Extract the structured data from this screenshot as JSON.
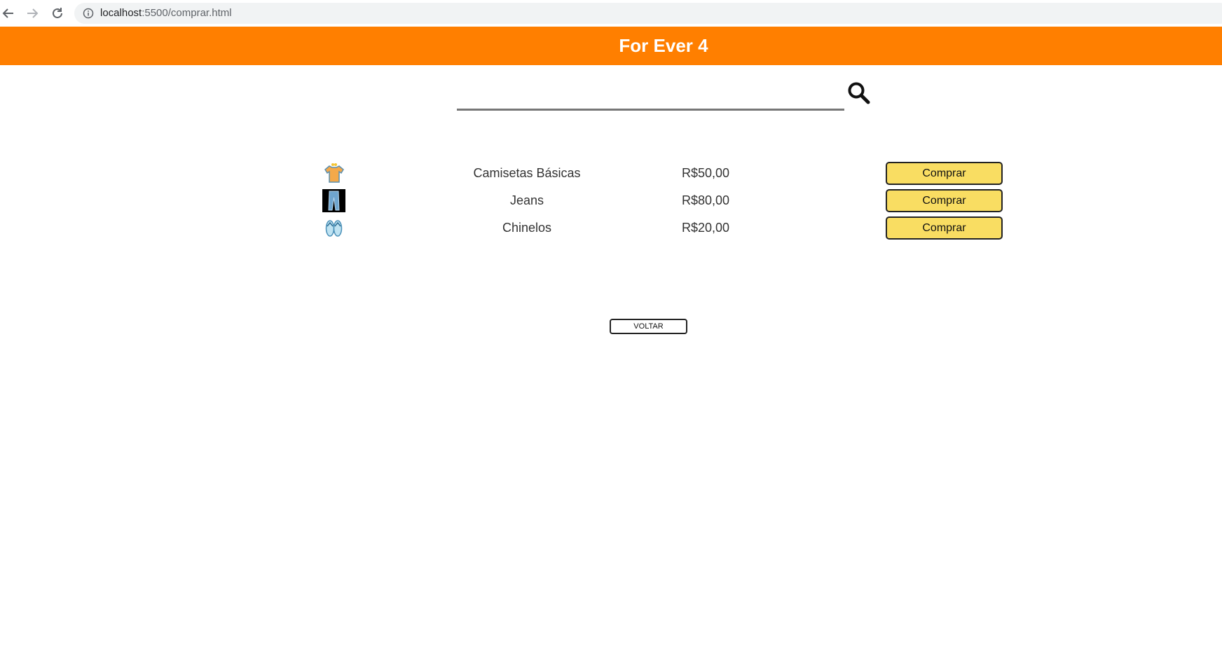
{
  "browser": {
    "url_host": "localhost",
    "url_path": ":5500/comprar.html"
  },
  "header": {
    "title": "For Ever 4",
    "color": "#ff7f00"
  },
  "search": {
    "value": "",
    "placeholder": ""
  },
  "products": [
    {
      "name": "Camisetas Básicas",
      "price": "R$50,00",
      "button": "Comprar",
      "icon": "tshirt-icon"
    },
    {
      "name": "Jeans",
      "price": "R$80,00",
      "button": "Comprar",
      "icon": "jeans-icon"
    },
    {
      "name": "Chinelos",
      "price": "R$20,00",
      "button": "Comprar",
      "icon": "flipflops-icon"
    }
  ],
  "back_button": "VOLTAR",
  "colors": {
    "buy_button": "#f9dd62"
  }
}
